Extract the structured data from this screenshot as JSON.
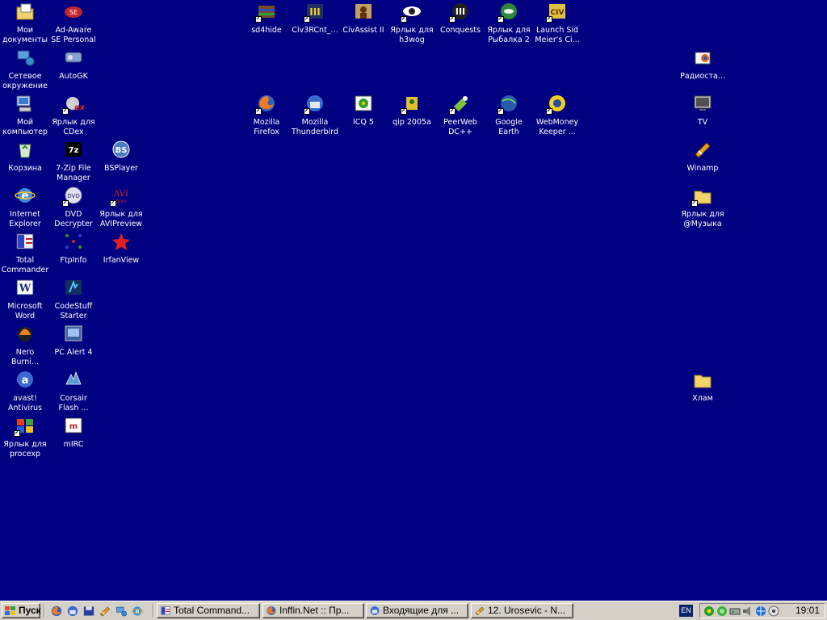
{
  "desktop": {
    "icons": [
      {
        "label": "Мои\nдокументы",
        "icon": "my-documents-icon",
        "shortcut": false
      },
      {
        "label": "Ad-Aware\nSE Personal",
        "icon": "ad-aware-icon",
        "shortcut": false
      },
      {
        "label": "Сетевое\nокружение",
        "icon": "network-icon",
        "shortcut": false
      },
      {
        "label": "AutoGK",
        "icon": "autogk-icon",
        "shortcut": false
      },
      {
        "label": "Мой\nкомпьютер",
        "icon": "my-computer-icon",
        "shortcut": false
      },
      {
        "label": "Ярлык для\nCDex",
        "icon": "cdex-icon",
        "shortcut": true
      },
      {
        "label": "Корзина",
        "icon": "recycle-bin-icon",
        "shortcut": false
      },
      {
        "label": "7-Zip File\nManager",
        "icon": "7zip-icon",
        "shortcut": false
      },
      {
        "label": "BSPlayer",
        "icon": "bsplayer-icon",
        "shortcut": false
      },
      {
        "label": "Internet\nExplorer",
        "icon": "internet-explorer-icon",
        "shortcut": false
      },
      {
        "label": "DVD\nDecrypter",
        "icon": "dvd-decrypter-icon",
        "shortcut": true
      },
      {
        "label": "Ярлык для\nAVIPreview",
        "icon": "avipreview-icon",
        "shortcut": true
      },
      {
        "label": "Total\nCommander",
        "icon": "total-commander-icon",
        "shortcut": false
      },
      {
        "label": "FtpInfo",
        "icon": "ftpinfo-icon",
        "shortcut": false
      },
      {
        "label": "IrfanView",
        "icon": "irfanview-icon",
        "shortcut": false
      },
      {
        "label": "Microsoft\nWord",
        "icon": "word-icon",
        "shortcut": false
      },
      {
        "label": "CodeStuff\nStarter",
        "icon": "codestuff-icon",
        "shortcut": false
      },
      {
        "label": "Nero\nBurni...",
        "icon": "nero-icon",
        "shortcut": false
      },
      {
        "label": "PC Alert 4",
        "icon": "pc-alert-icon",
        "shortcut": false
      },
      {
        "label": "avast!\nAntivirus",
        "icon": "avast-icon",
        "shortcut": false
      },
      {
        "label": "Corsair\nFlash ...",
        "icon": "corsair-icon",
        "shortcut": false
      },
      {
        "label": "Ярлык для\nprocexp",
        "icon": "procexp-icon",
        "shortcut": true
      },
      {
        "label": "mIRC",
        "icon": "mirc-icon",
        "shortcut": false
      },
      {
        "label": "sd4hide",
        "icon": "sd4hide-icon",
        "shortcut": true
      },
      {
        "label": "Civ3RCnt_...",
        "icon": "civ3-icon",
        "shortcut": true
      },
      {
        "label": "CivAssist II",
        "icon": "civassist-icon",
        "shortcut": false
      },
      {
        "label": "Ярлык для\nh3wog",
        "icon": "h3wog-icon",
        "shortcut": true
      },
      {
        "label": "Conquests",
        "icon": "conquests-icon",
        "shortcut": true
      },
      {
        "label": "Ярлык для\nРыбалка 2",
        "icon": "fishing-icon",
        "shortcut": true
      },
      {
        "label": "Launch Sid\nMeier's Ci...",
        "icon": "civ-launch-icon",
        "shortcut": true
      },
      {
        "label": "Mozilla\nFirefox",
        "icon": "firefox-icon",
        "shortcut": true
      },
      {
        "label": "Mozilla\nThunderbird",
        "icon": "thunderbird-icon",
        "shortcut": true
      },
      {
        "label": "ICQ 5",
        "icon": "icq-icon",
        "shortcut": false
      },
      {
        "label": "qip 2005a",
        "icon": "qip-icon",
        "shortcut": true
      },
      {
        "label": "PeerWeb\nDC++",
        "icon": "peerweb-icon",
        "shortcut": true
      },
      {
        "label": "Google\nEarth",
        "icon": "google-earth-icon",
        "shortcut": true
      },
      {
        "label": "WebMoney\nKeeper ...",
        "icon": "webmoney-icon",
        "shortcut": true
      },
      {
        "label": "Радиоста...",
        "icon": "radio-icon",
        "shortcut": false
      },
      {
        "label": "TV",
        "icon": "tv-icon",
        "shortcut": false
      },
      {
        "label": "Winamp",
        "icon": "winamp-icon",
        "shortcut": false
      },
      {
        "label": "Ярлык для\n@Музыка",
        "icon": "music-folder-icon",
        "shortcut": true
      },
      {
        "label": "Хлам",
        "icon": "folder-icon",
        "shortcut": false
      }
    ]
  },
  "taskbar": {
    "start_label": "Пуск",
    "quick_launch": [
      "firefox-icon",
      "thunderbird-icon",
      "floppy-icon",
      "winamp-icon",
      "network-icon",
      "ie-icon"
    ],
    "tasks": [
      {
        "label": "Total Command...",
        "icon": "total-commander-icon"
      },
      {
        "label": "Inffin.Net :: Пр...",
        "icon": "firefox-icon"
      },
      {
        "label": "Входящие для ...",
        "icon": "thunderbird-icon"
      },
      {
        "label": "12. Urosevic - N...",
        "icon": "winamp-icon"
      }
    ],
    "language": "EN",
    "clock": "19:01"
  },
  "colors": {
    "desktop": "#000080",
    "taskbar": "#d4d0c8"
  }
}
